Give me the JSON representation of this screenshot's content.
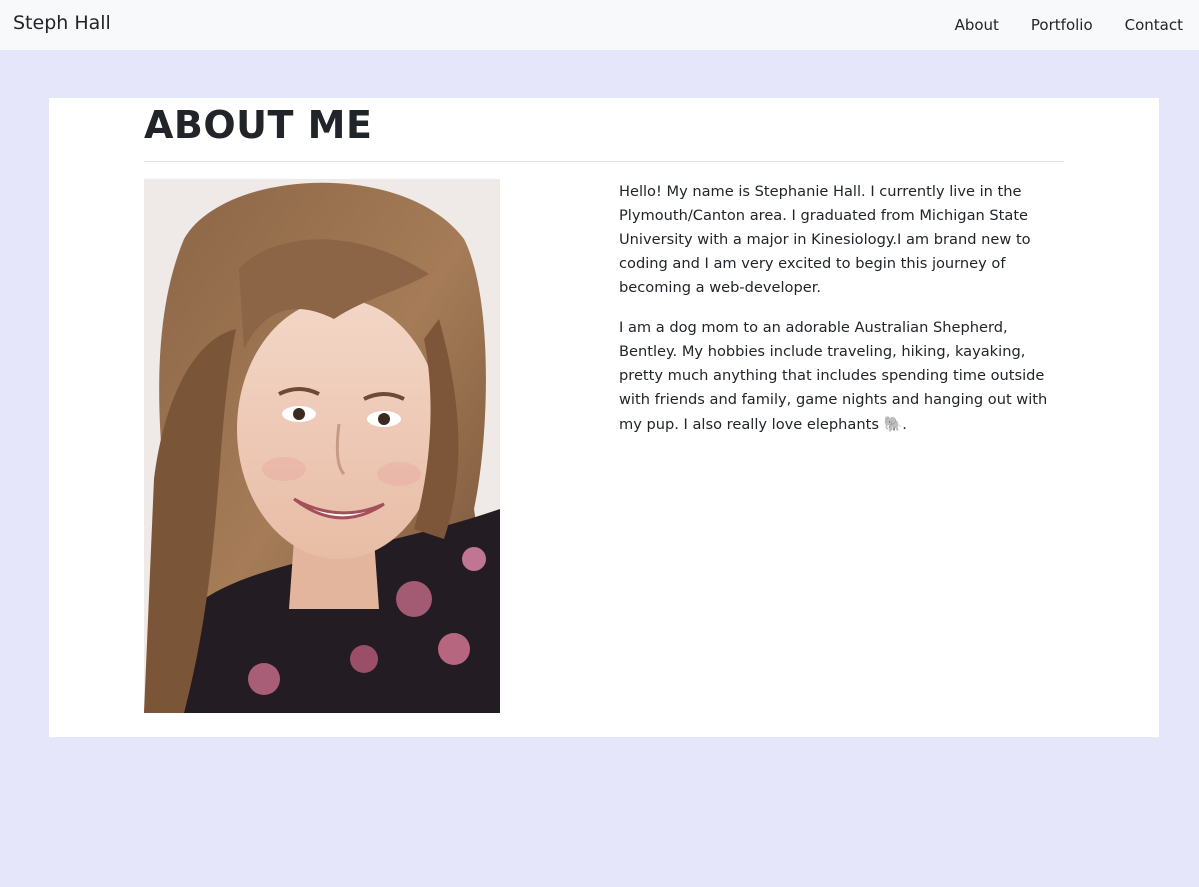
{
  "navbar": {
    "brand": "Steph Hall",
    "links": [
      "About",
      "Portfolio",
      "Contact"
    ]
  },
  "main": {
    "title": "ABOUT ME",
    "photo_alt": "Portrait photo of Stephanie Hall",
    "paragraphs": [
      "Hello! My name is Stephanie Hall. I currently live in the Plymouth/Canton area. I graduated from Michigan State University with a major in Kinesiology.I am brand new to coding and I am very excited to begin this journey of becoming a web-developer.",
      "I am a dog mom to an adorable Australian Shepherd, Bentley. My hobbies include traveling, hiking, kayaking, pretty much anything that includes spending time outside with friends and family, game nights and hanging out with my pup. I also really love elephants"
    ],
    "elephant_emoji": "🐘",
    "trailing_period": "."
  },
  "colors": {
    "page_background": "#e6e6fa",
    "navbar_background": "#f8f9fa",
    "card_background": "#ffffff",
    "text": "#212529"
  },
  "icons": {
    "elephant": "elephant-icon"
  }
}
